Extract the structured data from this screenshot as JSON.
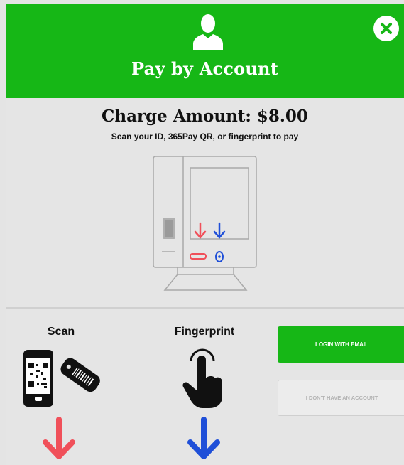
{
  "header": {
    "title": "Pay by Account",
    "user_icon": "user-silhouette-icon",
    "close_icon": "close-icon"
  },
  "charge": {
    "amount_text": "Charge Amount: $8.00",
    "instruction": "Scan your ID, 365Pay QR, or fingerprint to pay"
  },
  "methods": {
    "scan_label": "Scan",
    "fingerprint_label": "Fingerprint"
  },
  "actions": {
    "login_email": "LOGIN WITH EMAIL",
    "no_account": "I DON'T HAVE AN ACCOUNT"
  },
  "colors": {
    "brand_green": "#16b716",
    "scan_arrow": "#f0505a",
    "fingerprint_arrow": "#1f4fd8"
  }
}
